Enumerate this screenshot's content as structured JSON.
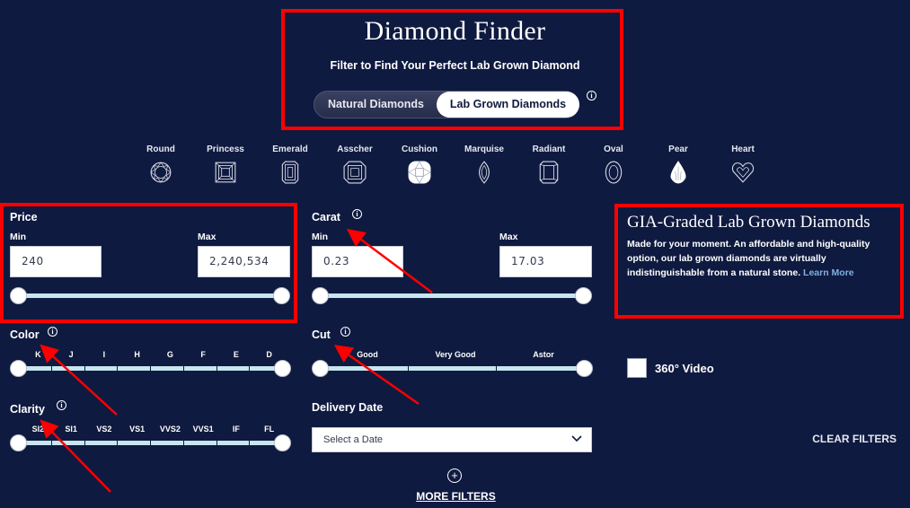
{
  "header": {
    "title": "Diamond Finder",
    "subtitle": "Filter to Find Your Perfect Lab Grown Diamond",
    "toggle": {
      "options": [
        "Natural Diamonds",
        "Lab Grown Diamonds"
      ],
      "selected": "Lab Grown Diamonds"
    },
    "info_icon": "i"
  },
  "shapes": [
    {
      "label": "Round",
      "icon": "round-diamond-icon",
      "selected": false
    },
    {
      "label": "Princess",
      "icon": "princess-diamond-icon",
      "selected": false
    },
    {
      "label": "Emerald",
      "icon": "emerald-diamond-icon",
      "selected": false
    },
    {
      "label": "Asscher",
      "icon": "asscher-diamond-icon",
      "selected": false
    },
    {
      "label": "Cushion",
      "icon": "cushion-diamond-icon",
      "selected": true
    },
    {
      "label": "Marquise",
      "icon": "marquise-diamond-icon",
      "selected": false
    },
    {
      "label": "Radiant",
      "icon": "radiant-diamond-icon",
      "selected": false
    },
    {
      "label": "Oval",
      "icon": "oval-diamond-icon",
      "selected": false
    },
    {
      "label": "Pear",
      "icon": "pear-diamond-icon",
      "selected": true
    },
    {
      "label": "Heart",
      "icon": "heart-diamond-icon",
      "selected": false
    }
  ],
  "price": {
    "title": "Price",
    "min_label": "Min",
    "max_label": "Max",
    "min_value": "240",
    "max_value": "2,240,534",
    "range_fraction": [
      0,
      1
    ]
  },
  "carat": {
    "title": "Carat",
    "min_label": "Min",
    "max_label": "Max",
    "min_value": "0.23",
    "max_value": "17.03",
    "range_fraction": [
      0,
      1
    ]
  },
  "color": {
    "title": "Color",
    "grades": [
      "K",
      "J",
      "I",
      "H",
      "G",
      "F",
      "E",
      "D"
    ],
    "range_fraction": [
      0,
      1
    ]
  },
  "cut": {
    "title": "Cut",
    "grades": [
      "Good",
      "Very Good",
      "Astor"
    ],
    "range_fraction": [
      0,
      1
    ]
  },
  "clarity": {
    "title": "Clarity",
    "grades": [
      "SI2",
      "SI1",
      "VS2",
      "VS1",
      "VVS2",
      "VVS1",
      "IF",
      "FL"
    ],
    "range_fraction": [
      0,
      1
    ]
  },
  "delivery": {
    "title": "Delivery Date",
    "placeholder": "Select a Date"
  },
  "info_panel": {
    "title": "GIA-Graded Lab Grown Diamonds",
    "body": "Made for your moment. An affordable and high-quality option, our lab grown diamonds are virtually indistinguishable from a natural stone.",
    "link": "Learn More"
  },
  "video_filter": {
    "label": "360° Video",
    "checked": false
  },
  "actions": {
    "clear_filters": "CLEAR FILTERS",
    "more_filters": "MORE FILTERS",
    "more_icon": "+"
  },
  "colors": {
    "background": "#0f1a40",
    "track": "#c7e6f0",
    "link": "#7fb0e0",
    "annotation": "#ff0000"
  }
}
